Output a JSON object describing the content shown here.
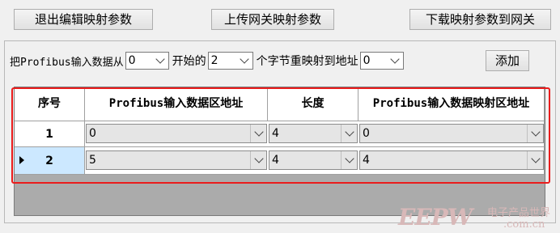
{
  "toolbar": {
    "exit_edit": "退出编辑映射参数",
    "upload": "上传网关映射参数",
    "download": "下载映射参数到网关"
  },
  "mapping_row": {
    "prefix": "把Profibus输入数据从",
    "from_value": "0",
    "start_label": "开始的",
    "count_value": "2",
    "mid_label": "个字节重映射到地址",
    "to_value": "0",
    "add_label": "添加"
  },
  "table": {
    "headers": [
      "序号",
      "Profibus输入数据区地址",
      "长度",
      "Profibus输入数据映射区地址"
    ],
    "rows": [
      {
        "index": "1",
        "input_addr": "0",
        "length": "4",
        "map_addr": "0"
      },
      {
        "index": "2",
        "input_addr": "5",
        "length": "4",
        "map_addr": "4"
      }
    ]
  },
  "watermark": {
    "logo": "EEPW",
    "domain": ".com.cn",
    "tagline": "电子产品世界"
  }
}
